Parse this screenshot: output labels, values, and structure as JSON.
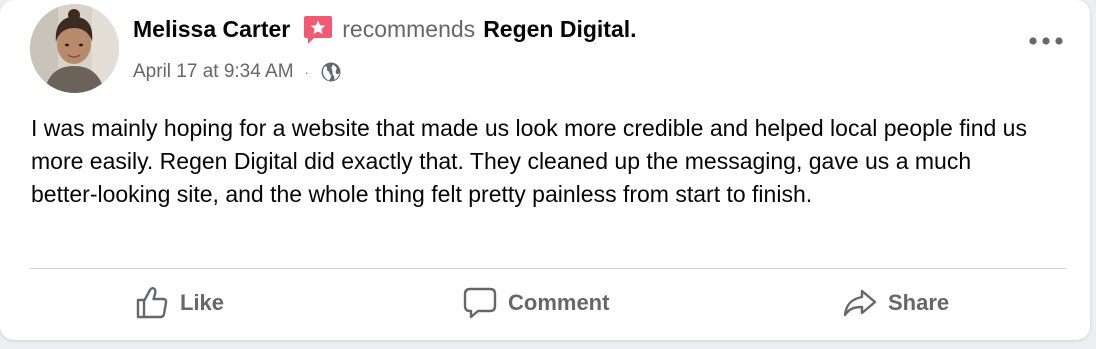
{
  "post": {
    "author": "Melissa Carter",
    "verb": "recommends",
    "page_name": "Regen Digital.",
    "timestamp": "April 17 at 9:34 AM",
    "separator": "·",
    "privacy_icon": "globe-icon",
    "body": "I was mainly hoping for a website that made us look more credible and helped local people find us more easily. Regen Digital did exactly that. They cleaned up the messaging, gave us a much better-looking site, and the whole thing felt pretty painless from start to finish."
  },
  "actions": {
    "like_label": "Like",
    "comment_label": "Comment",
    "share_label": "Share"
  },
  "icons": {
    "badge": "recommend-badge-icon",
    "more": "more-options-icon",
    "like": "thumbs-up-icon",
    "comment": "comment-bubble-icon",
    "share": "share-arrow-icon"
  },
  "colors": {
    "badge": "#f05a72",
    "secondary_text": "#65676b",
    "primary_text": "#050505"
  }
}
